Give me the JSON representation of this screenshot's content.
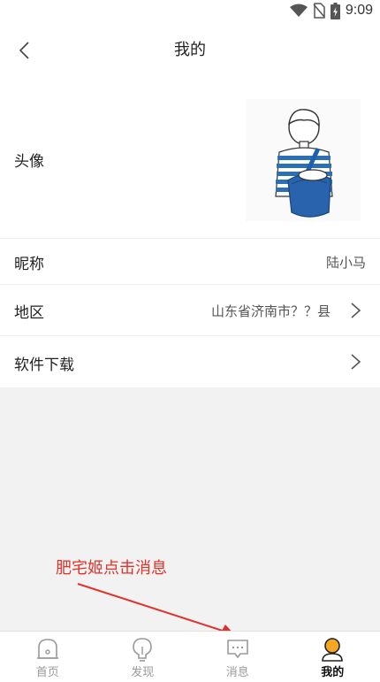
{
  "status_bar": {
    "time": "9:09",
    "icons": [
      "wifi-icon",
      "no-sim-icon",
      "battery-charging-icon"
    ]
  },
  "header": {
    "title": "我的",
    "back_icon": "chevron-left-icon"
  },
  "profile": {
    "avatar_label": "头像",
    "nickname_label": "昵称",
    "nickname_value": "陆小马",
    "region_label": "地区",
    "region_value": "山东省济南市？？县",
    "download_label": "软件下载"
  },
  "annotation": {
    "text": "肥宅姬点击消息",
    "color": "#e0322a"
  },
  "tabbar": {
    "tabs": [
      {
        "label": "首页",
        "icon": "home-icon",
        "active": false
      },
      {
        "label": "发现",
        "icon": "lightbulb-icon",
        "active": false
      },
      {
        "label": "消息",
        "icon": "message-icon",
        "active": false
      },
      {
        "label": "我的",
        "icon": "user-icon",
        "active": true
      }
    ],
    "active_color": "#f5a623"
  }
}
